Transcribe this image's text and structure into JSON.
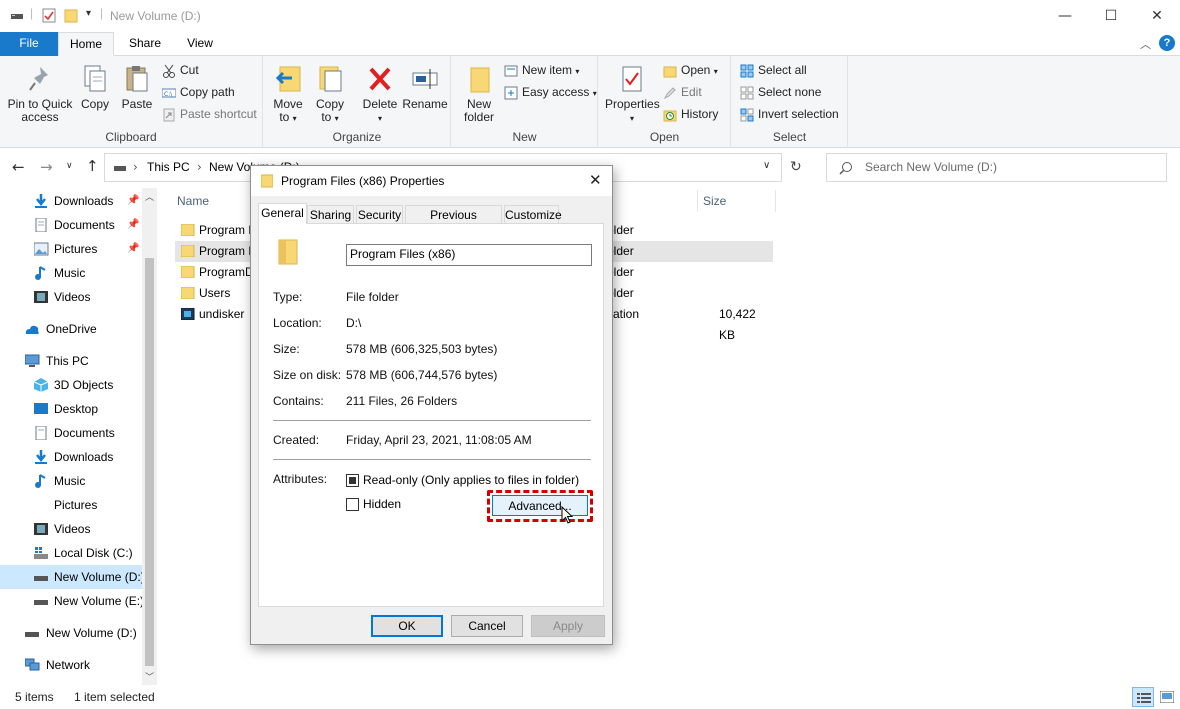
{
  "window": {
    "title": "New Volume (D:)",
    "minimize": "—",
    "maximize": "☐",
    "close": "✕",
    "help": "?"
  },
  "ribbon_tabs": {
    "file": "File",
    "home": "Home",
    "share": "Share",
    "view": "View"
  },
  "ribbon": {
    "clipboard": {
      "label": "Clipboard",
      "pin_line1": "Pin to Quick",
      "pin_line2": "access",
      "copy": "Copy",
      "paste": "Paste",
      "cut": "Cut",
      "copy_path": "Copy path",
      "paste_shortcut": "Paste shortcut"
    },
    "organize": {
      "label": "Organize",
      "move_line1": "Move",
      "move_line2": "to",
      "copy_line1": "Copy",
      "copy_line2": "to",
      "delete": "Delete",
      "rename": "Rename"
    },
    "new": {
      "label": "New",
      "folder_line1": "New",
      "folder_line2": "folder",
      "new_item": "New item",
      "easy_access": "Easy access"
    },
    "open": {
      "label": "Open",
      "properties": "Properties",
      "open": "Open",
      "edit": "Edit",
      "history": "History"
    },
    "select": {
      "label": "Select",
      "select_all": "Select all",
      "select_none": "Select none",
      "invert": "Invert selection"
    }
  },
  "address": {
    "crumb1": "This PC",
    "crumb2": "New Volume (D:)",
    "sep": "›",
    "search_placeholder": "Search New Volume (D:)"
  },
  "nav": {
    "quick": [
      "Downloads",
      "Documents",
      "Pictures",
      "Music",
      "Videos"
    ],
    "onedrive": "OneDrive",
    "this_pc": "This PC",
    "pc_items": [
      "3D Objects",
      "Desktop",
      "Documents",
      "Downloads",
      "Music",
      "Pictures",
      "Videos",
      "Local Disk (C:)",
      "New Volume (D:)",
      "New Volume (E:)"
    ],
    "volume_d": "New Volume (D:)",
    "network": "Network"
  },
  "files": {
    "col_name": "Name",
    "col_size": "Size",
    "rows": [
      {
        "name": "Program F",
        "type": "older",
        "size": ""
      },
      {
        "name": "Program F",
        "type": "older",
        "size": ""
      },
      {
        "name": "ProgramD",
        "type": "older",
        "size": ""
      },
      {
        "name": "Users",
        "type": "older",
        "size": ""
      },
      {
        "name": "undisker",
        "type": "cation",
        "size": "10,422 KB"
      }
    ]
  },
  "status": {
    "items": "5 items",
    "selected": "1 item selected"
  },
  "dialog": {
    "title": "Program Files (x86) Properties",
    "tabs": [
      "General",
      "Sharing",
      "Security",
      "Previous Versions",
      "Customize"
    ],
    "name_value": "Program Files (x86)",
    "type_label": "Type:",
    "type_value": "File folder",
    "location_label": "Location:",
    "location_value": "D:\\",
    "size_label": "Size:",
    "size_value": "578 MB (606,325,503 bytes)",
    "size_disk_label": "Size on disk:",
    "size_disk_value": "578 MB (606,744,576 bytes)",
    "contains_label": "Contains:",
    "contains_value": "211 Files, 26 Folders",
    "created_label": "Created:",
    "created_value": "Friday, April 23, 2021, 11:08:05 AM",
    "attributes_label": "Attributes:",
    "readonly_label": "Read-only (Only applies to files in folder)",
    "hidden_label": "Hidden",
    "advanced": "Advanced...",
    "ok": "OK",
    "cancel": "Cancel",
    "apply": "Apply"
  },
  "colors": {
    "accent": "#1979ca",
    "selection": "#cce8ff",
    "folder": "#f8d775",
    "highlight_border": "#d40000"
  }
}
